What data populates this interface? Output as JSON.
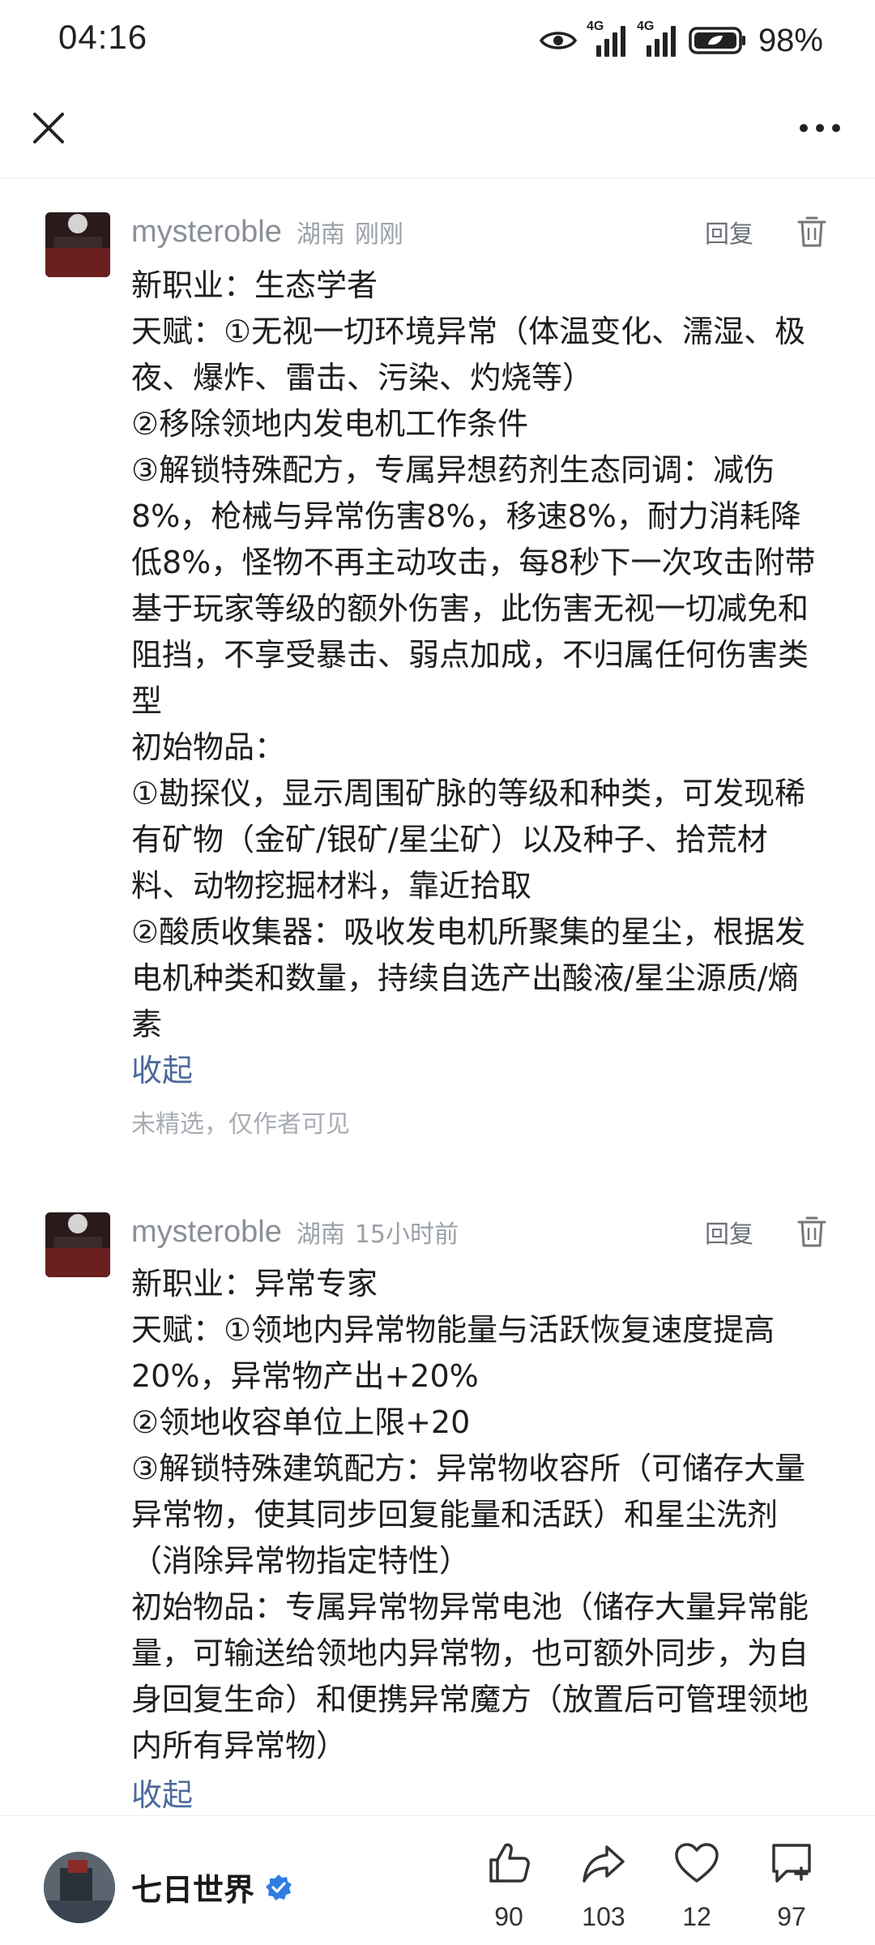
{
  "status_bar": {
    "time": "04:16",
    "network_1": "4G",
    "network_2": "4G",
    "battery": "98%"
  },
  "nav": {
    "close_icon": "close-icon",
    "more_icon": "more-icon"
  },
  "comments": [
    {
      "username": "mysteroble",
      "location": "湖南",
      "time": "刚刚",
      "reply_label": "回复",
      "lines": [
        "新职业：生态学者",
        "天赋：①无视一切环境异常（体温变化、濡湿、极夜、爆炸、雷击、污染、灼烧等）",
        "②移除领地内发电机工作条件",
        "③解锁特殊配方，专属异想药剂生态同调：减伤8%，枪械与异常伤害8%，移速8%，耐力消耗降低8%，怪物不再主动攻击，每8秒下一次攻击附带基于玩家等级的额外伤害，此伤害无视一切减免和阻挡，不享受暴击、弱点加成，不归属任何伤害类型",
        "初始物品：",
        "①勘探仪，显示周围矿脉的等级和种类，可发现稀有矿物（金矿/银矿/星尘矿）以及种子、拾荒材料、动物挖掘材料，靠近拾取",
        "②酸质收集器：吸收发电机所聚集的星尘，根据发电机种类和数量，持续自选产出酸液/星尘源质/熵素"
      ],
      "collapse_label": "收起",
      "visibility_note": "未精选，仅作者可见"
    },
    {
      "username": "mysteroble",
      "location": "湖南",
      "time": "15小时前",
      "reply_label": "回复",
      "lines": [
        "新职业：异常专家",
        "天赋：①领地内异常物能量与活跃恢复速度提高20%，异常物产出+20%",
        "②领地收容单位上限+20",
        "③解锁特殊建筑配方：异常物收容所（可储存大量异常物，使其同步回复能量和活跃）和星尘洗剂（消除异常物指定特性）",
        "初始物品：专属异常物异常电池（储存大量异常能量，可输送给领地内异常物，也可额外同步，为自身回复生命）和便携异常魔方（放置后可管理领地内所有异常物）"
      ],
      "collapse_label": "收起"
    }
  ],
  "bottom_bar": {
    "account_name": "七日世界",
    "likes": "90",
    "shares": "103",
    "favorites": "12",
    "comments": "97"
  }
}
